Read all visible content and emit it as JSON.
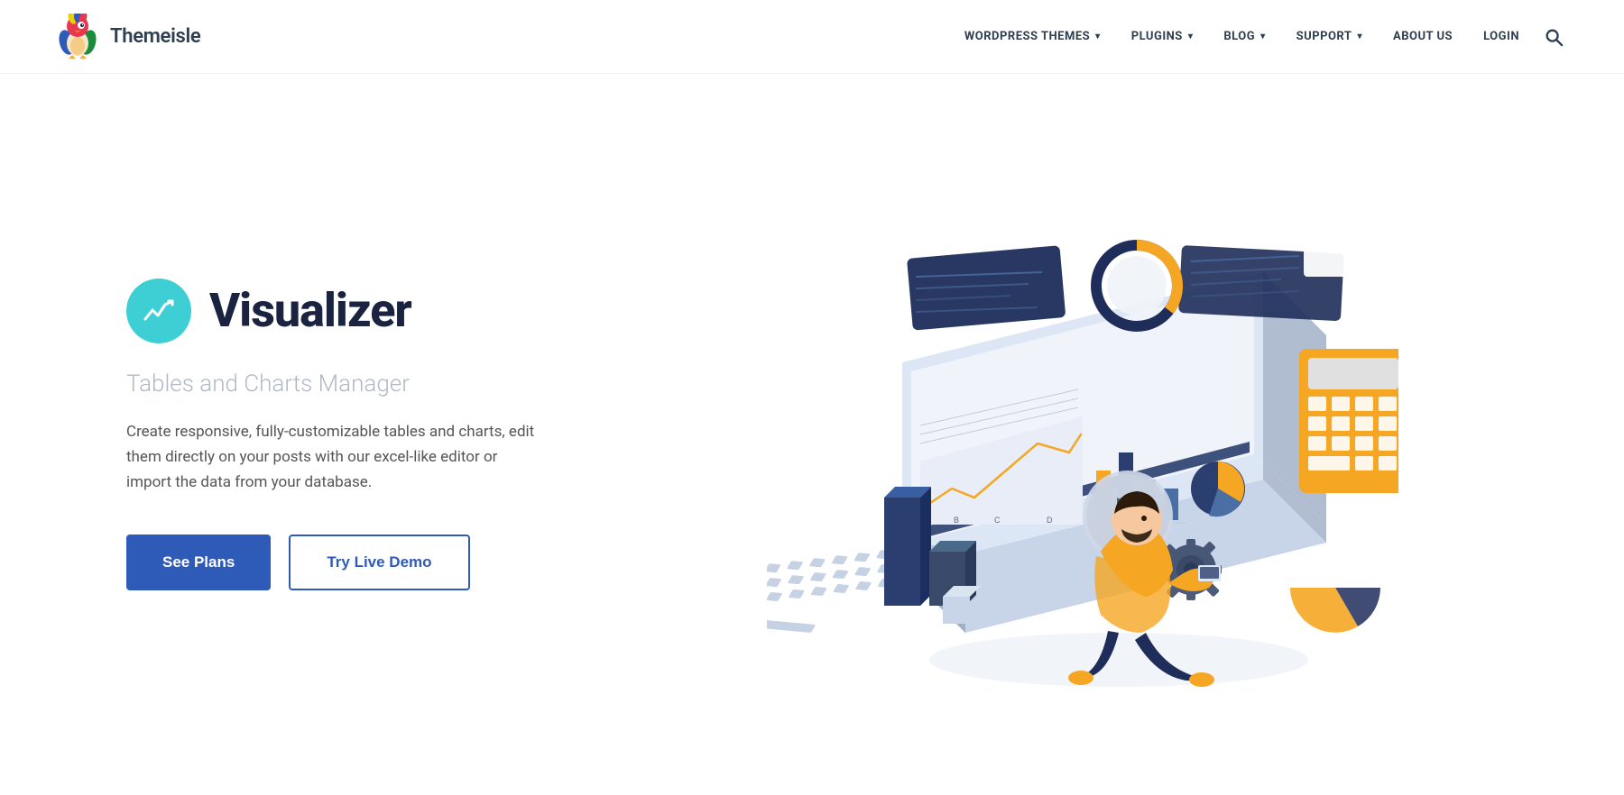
{
  "header": {
    "logo_text": "Themeisle",
    "nav_items": [
      {
        "id": "wordpress-themes",
        "label": "WORDPRESS THEMES",
        "has_dropdown": true
      },
      {
        "id": "plugins",
        "label": "PLUGINS",
        "has_dropdown": true
      },
      {
        "id": "blog",
        "label": "BLOG",
        "has_dropdown": true
      },
      {
        "id": "support",
        "label": "SUPPORT",
        "has_dropdown": true
      },
      {
        "id": "about-us",
        "label": "ABOUT US",
        "has_dropdown": false
      },
      {
        "id": "login",
        "label": "LOGIN",
        "has_dropdown": false
      }
    ]
  },
  "hero": {
    "title": "Visualizer",
    "subtitle": "Tables and Charts Manager",
    "description": "Create responsive, fully-customizable tables and charts, edit them directly on your posts with our excel-like editor or import the data from your database.",
    "btn_primary_label": "See Plans",
    "btn_outline_label": "Try Live Demo"
  },
  "colors": {
    "accent_blue": "#2f5bb8",
    "icon_teal": "#3ecfd4",
    "text_dark": "#1a2340",
    "text_gray": "#b0b8c8",
    "text_body": "#555"
  }
}
